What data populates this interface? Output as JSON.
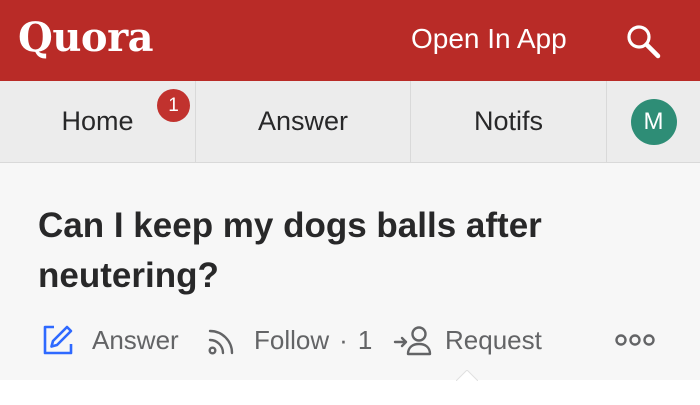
{
  "header": {
    "logo": "Quora",
    "open_in_app": "Open In App",
    "search_icon": "search-icon"
  },
  "nav": {
    "tabs": [
      {
        "label": "Home",
        "badge": "1"
      },
      {
        "label": "Answer"
      },
      {
        "label": "Notifs"
      }
    ],
    "profile_initial": "M"
  },
  "question": {
    "title": "Can I keep my dogs balls after neutering?"
  },
  "actions": {
    "answer_label": "Answer",
    "follow_label": "Follow",
    "follow_separator": "·",
    "follow_count": "1",
    "request_label": "Request",
    "more_icon": "more-icon"
  },
  "colors": {
    "brand": "#b92b27",
    "badge": "#c1322e",
    "avatar": "#2e8d76",
    "answer_icon": "#2e69ff",
    "nav_bg": "#ececec",
    "content_bg": "#f7f7f7",
    "action_text": "#636466"
  }
}
